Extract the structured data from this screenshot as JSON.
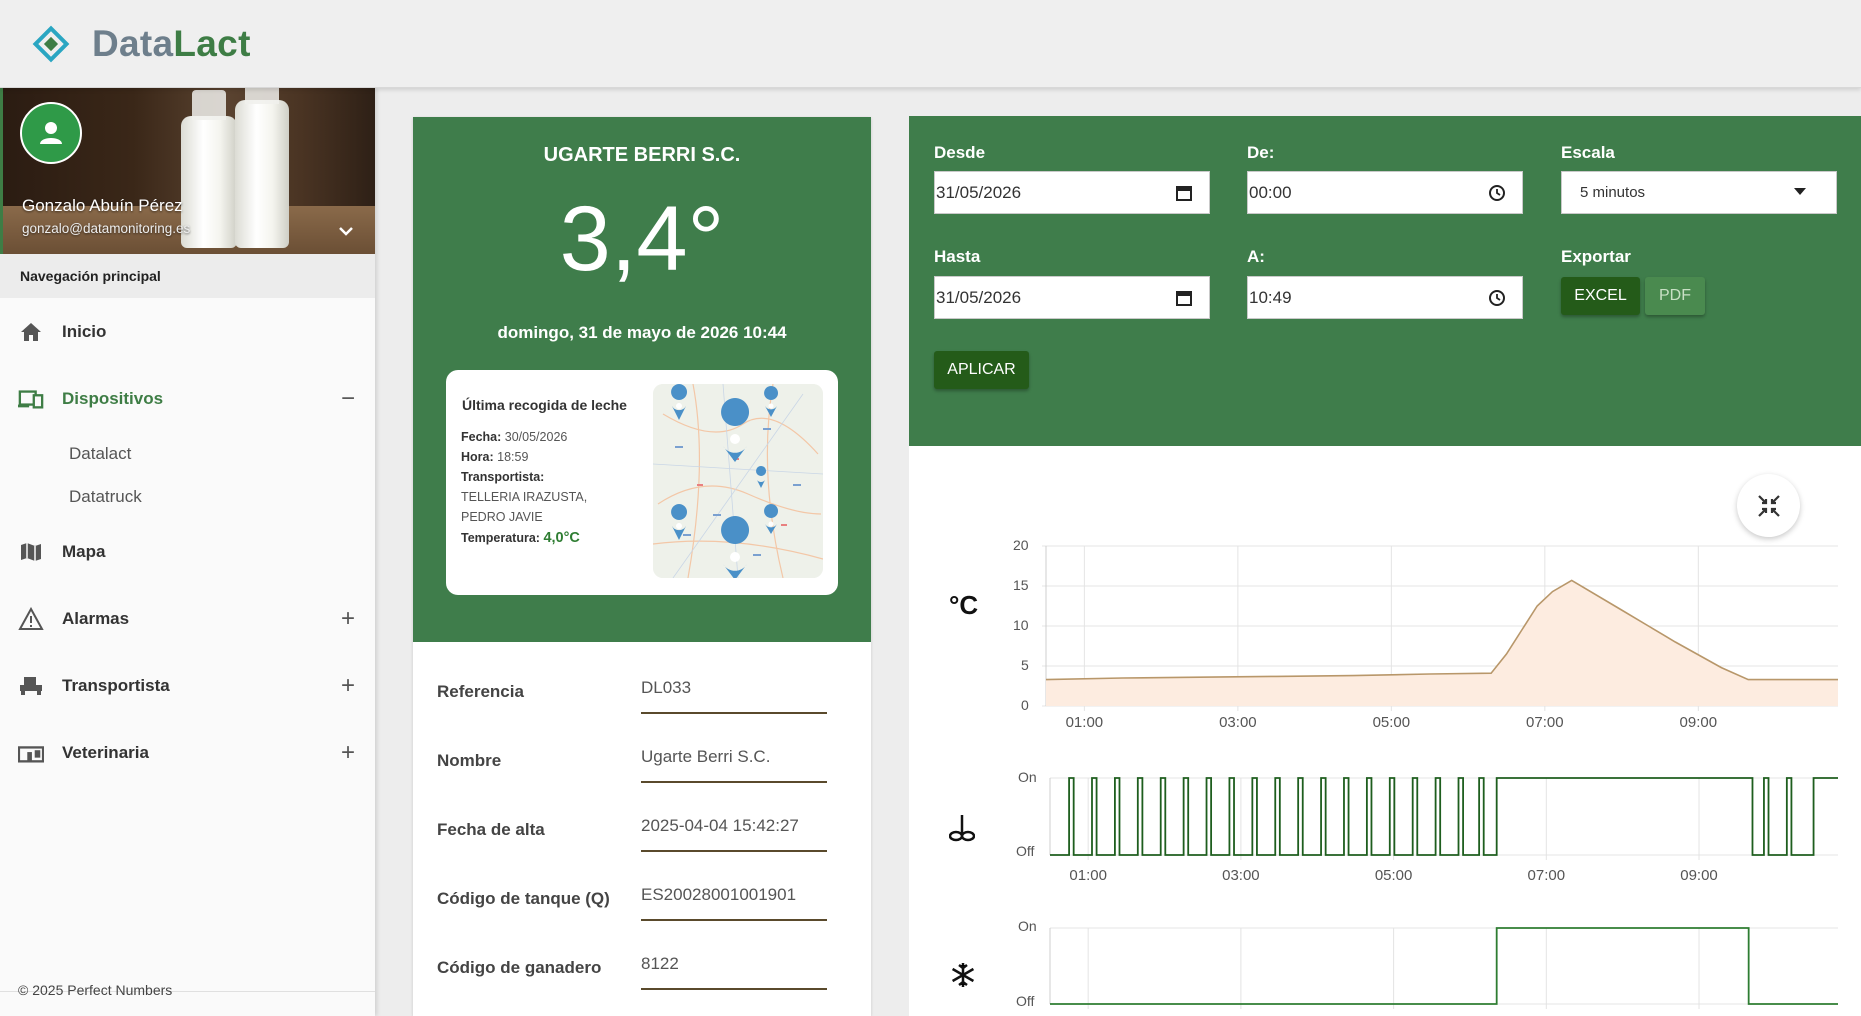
{
  "app": {
    "brand_part1": "Data",
    "brand_part2": "Lact"
  },
  "profile": {
    "name": "Gonzalo Abuín Pérez",
    "email": "gonzalo@datamonitoring.es"
  },
  "nav": {
    "header": "Navegación principal",
    "items": [
      {
        "label": "Inicio",
        "icon": "home-icon"
      },
      {
        "label": "Dispositivos",
        "icon": "devices-icon",
        "toggle": "−",
        "active": true
      },
      {
        "label": "Mapa",
        "icon": "map-icon"
      },
      {
        "label": "Alarmas",
        "icon": "warning-icon",
        "toggle": "+"
      },
      {
        "label": "Transportista",
        "icon": "truck-icon",
        "toggle": "+"
      },
      {
        "label": "Veterinaria",
        "icon": "vet-icon",
        "toggle": "+"
      }
    ],
    "subitems": [
      "Datalact",
      "Datatruck"
    ],
    "footer": "© 2025 Perfect Numbers"
  },
  "device": {
    "company": "UGARTE BERRI S.C.",
    "temperature": "3,4°",
    "datetime": "domingo, 31 de mayo de 2026 10:44",
    "pickup": {
      "title": "Última recogida de leche",
      "fecha_label": "Fecha:",
      "fecha": "30/05/2026",
      "hora_label": "Hora:",
      "hora": "18:59",
      "transportista_label": "Transportista:",
      "transportista": "TELLERIA IRAZUSTA, PEDRO JAVIE",
      "temperatura_label": "Temperatura:",
      "temperatura": "4,0°C"
    },
    "fields": [
      {
        "label": "Referencia",
        "value": "DL033"
      },
      {
        "label": "Nombre",
        "value": "Ugarte Berri S.C."
      },
      {
        "label": "Fecha de alta",
        "value": "2025-04-04 15:42:27"
      },
      {
        "label": "Código de tanque (Q)",
        "value": "ES20028001001901"
      },
      {
        "label": "Código de ganadero",
        "value": "8122"
      }
    ]
  },
  "filters": {
    "desde_label": "Desde",
    "desde": "31/05/2026",
    "de_label": "De:",
    "de": "00:00",
    "escala_label": "Escala",
    "escala": "5 minutos",
    "hasta_label": "Hasta",
    "hasta": "31/05/2026",
    "a_label": "A:",
    "a": "10:49",
    "exportar_label": "Exportar",
    "excel": "EXCEL",
    "pdf": "PDF",
    "aplicar": "APLICAR"
  },
  "chart_data": [
    {
      "type": "area",
      "icon_text": "°C",
      "ylim": [
        0,
        20
      ],
      "yticks": [
        0,
        5,
        10,
        15,
        20
      ],
      "xlim": [
        0.5,
        10.82
      ],
      "xticks": [
        "01:00",
        "03:00",
        "05:00",
        "07:00",
        "09:00"
      ],
      "x": [
        0.5,
        1.5,
        2.5,
        3.5,
        4.5,
        5.5,
        6.3,
        6.5,
        6.7,
        6.9,
        7.1,
        7.35,
        8.0,
        8.7,
        9.3,
        9.65,
        10.0,
        10.82
      ],
      "values": [
        3.3,
        3.5,
        3.6,
        3.7,
        3.8,
        4.0,
        4.1,
        6.5,
        9.5,
        12.5,
        14.3,
        15.7,
        12.0,
        8.0,
        4.8,
        3.3,
        3.3,
        3.3
      ],
      "grid": true,
      "line_color": "#b8976a",
      "fill_color": "#fdece0"
    },
    {
      "type": "line",
      "icon": "agitator-icon",
      "y_labels": [
        "On",
        "Off"
      ],
      "xlim": [
        0.5,
        10.82
      ],
      "xticks": [
        "01:00",
        "03:00",
        "05:00",
        "07:00",
        "09:00"
      ],
      "on_intervals": [
        [
          0.75,
          0.81
        ],
        [
          1.05,
          1.11
        ],
        [
          1.35,
          1.41
        ],
        [
          1.65,
          1.71
        ],
        [
          1.95,
          2.01
        ],
        [
          2.25,
          2.31
        ],
        [
          2.55,
          2.61
        ],
        [
          2.85,
          2.91
        ],
        [
          3.15,
          3.21
        ],
        [
          3.45,
          3.51
        ],
        [
          3.75,
          3.81
        ],
        [
          4.05,
          4.11
        ],
        [
          4.35,
          4.41
        ],
        [
          4.65,
          4.71
        ],
        [
          4.95,
          5.01
        ],
        [
          5.25,
          5.31
        ],
        [
          5.55,
          5.61
        ],
        [
          5.85,
          5.91
        ],
        [
          6.12,
          6.18
        ],
        [
          6.35,
          9.7
        ],
        [
          9.85,
          9.91
        ],
        [
          10.15,
          10.21
        ],
        [
          10.5,
          10.82
        ]
      ],
      "line_color": "#1e5e1e"
    },
    {
      "type": "line",
      "icon": "snowflake-icon",
      "y_labels": [
        "On",
        "Off"
      ],
      "xlim": [
        0.5,
        10.82
      ],
      "on_intervals": [
        [
          6.35,
          9.65
        ]
      ],
      "line_color": "#2e7d32"
    }
  ]
}
